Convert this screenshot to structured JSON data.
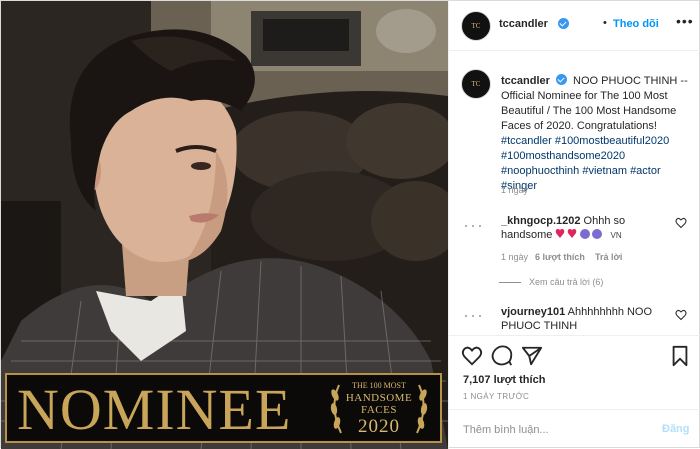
{
  "brand": {
    "accent": "#0095f6",
    "verified": "#3897f0",
    "gold": "#c9a55a"
  },
  "photo": {
    "banner": {
      "word": "NOMINEE",
      "seal_line1": "THE 100 MOST",
      "seal_line2": "HANDSOME",
      "seal_line3": "FACES",
      "seal_year": "2020"
    },
    "avatar_text": "TC"
  },
  "header": {
    "username": "tccandler",
    "separator": "•",
    "follow_label": "Theo dõi",
    "more_icon": "more-horizontal-icon"
  },
  "caption": {
    "username": "tccandler",
    "text": "NOO PHUOC THINH -- Official Nominee for The 100 Most Beautiful / The 100 Most Handsome Faces of 2020. Congratulations!",
    "hashtags": [
      "#tccandler",
      "#100mostbeautiful2020",
      "#100mosthandsome2020",
      "#noophuocthinh",
      "#vietnam",
      "#actor",
      "#singer"
    ],
    "time": "1 ngày"
  },
  "comments": [
    {
      "username": "_khngocp.1202",
      "text": "Ohhh so handsome",
      "emoji_suffix": "VN",
      "time": "1 ngày",
      "likes": "6 lượt thích",
      "reply_label": "Trả lời",
      "view_replies": "Xem câu trả lời (6)"
    },
    {
      "username": "vjourney101",
      "text": "Ahhhhhhhh NOO PHUOC THINH"
    }
  ],
  "actions": {
    "like_icon": "heart-icon",
    "comment_icon": "comment-icon",
    "share_icon": "send-icon",
    "save_icon": "bookmark-icon",
    "likes": "7,107 lượt thích",
    "date": "1 NGÀY TRƯỚC"
  },
  "add_comment": {
    "placeholder": "Thêm bình luận...",
    "post_label": "Đăng"
  }
}
